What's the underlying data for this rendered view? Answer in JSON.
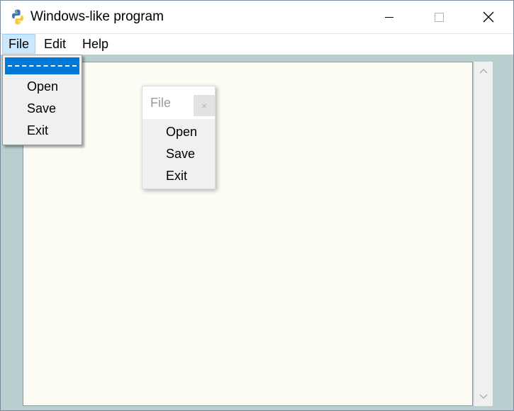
{
  "window": {
    "title": "Windows-like program",
    "minimize_icon": "minimize-icon",
    "maximize_icon": "maximize-icon",
    "close_icon": "close-icon"
  },
  "menubar": {
    "items": [
      {
        "label": "File",
        "active": true
      },
      {
        "label": "Edit"
      },
      {
        "label": "Help"
      }
    ]
  },
  "file_menu": {
    "tearoff_icon": "tearoff-dashed-line",
    "items": [
      {
        "label": "Open"
      },
      {
        "label": "Save"
      },
      {
        "label": "Exit"
      }
    ]
  },
  "torn_off_menu": {
    "title": "File",
    "close_glyph": "×",
    "items": [
      {
        "label": "Open"
      },
      {
        "label": "Save"
      },
      {
        "label": "Exit"
      }
    ]
  },
  "editor": {
    "content": ""
  },
  "colors": {
    "highlight": "#0078d7",
    "menu_active_bg": "#cce8ff",
    "editor_bg": "#fcfcf4",
    "window_bg": "#b8cfd0",
    "menu_bg": "#f0f0f0"
  }
}
